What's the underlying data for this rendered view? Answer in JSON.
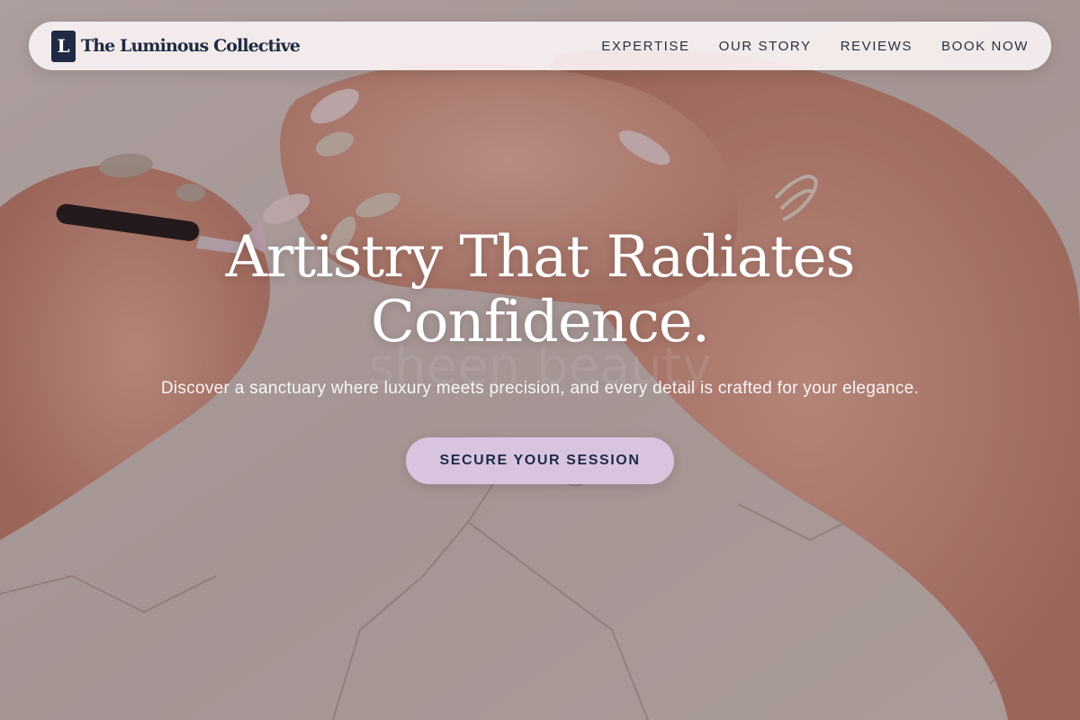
{
  "brand": {
    "logo_letter": "L",
    "name": "The Luminous Collective"
  },
  "nav": {
    "items": [
      {
        "label": "EXPERTISE"
      },
      {
        "label": "OUR STORY"
      },
      {
        "label": "REVIEWS"
      },
      {
        "label": "BOOK NOW"
      }
    ]
  },
  "hero": {
    "title": "Artistry That Radiates Confidence.",
    "subtitle": "Discover a sanctuary where luxury meets precision, and every detail is crafted for your elegance.",
    "cta_label": "SECURE YOUR SESSION",
    "background_image": "manicure-hands-on-marble"
  },
  "colors": {
    "brand_navy": "#1f2a44",
    "cta_lilac": "#d9c4df",
    "navbar_bg": "#f8f2f2"
  }
}
